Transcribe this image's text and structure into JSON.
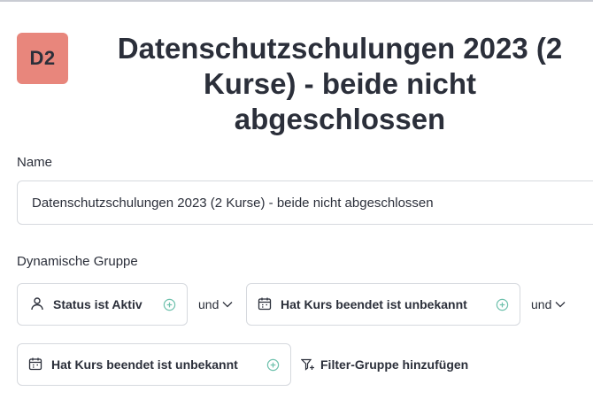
{
  "header": {
    "avatar_text": "D2",
    "title_line1": "Datenschutzschulungen 2023 (2",
    "title_line2": "Kurse) - beide nicht",
    "title_line3": "abgeschlossen"
  },
  "form": {
    "name_label": "Name",
    "name_value": "Datenschutzschulungen 2023 (2 Kurse) - beide nicht abgeschlossen",
    "group_label": "Dynamische Gruppe"
  },
  "filters": [
    {
      "label": "Status ist Aktiv",
      "icon": "user-icon"
    },
    {
      "label": "Hat Kurs beendet ist unbekannt",
      "icon": "calendar-icon"
    },
    {
      "label": "Hat Kurs beendet ist unbekannt",
      "icon": "calendar-icon"
    }
  ],
  "connectors": [
    "und",
    "und"
  ],
  "add_filter_group_label": "Filter-Gruppe hinzufügen",
  "colors": {
    "avatar_bg": "#e8867c",
    "accent_plus": "#6fc1ad"
  }
}
